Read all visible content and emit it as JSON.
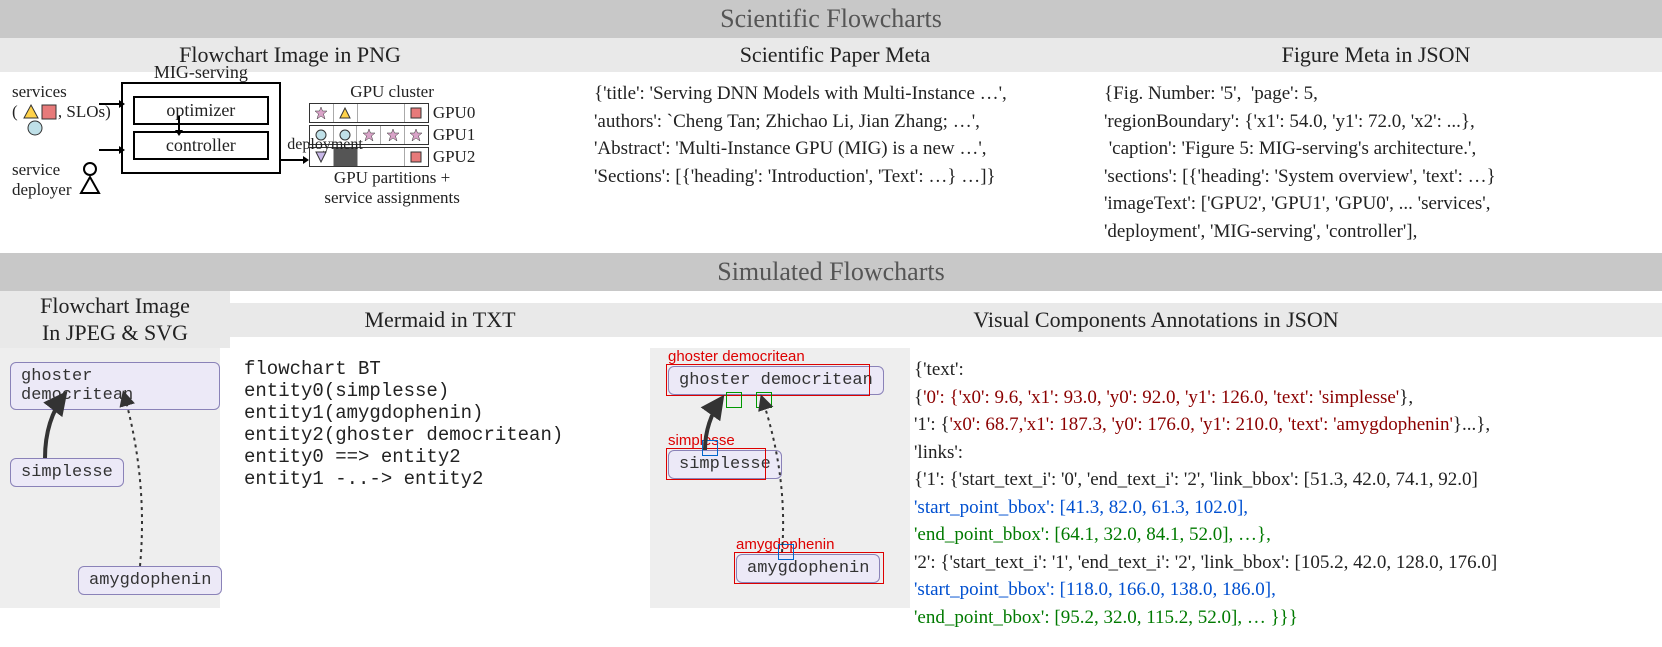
{
  "banners": {
    "scientific": "Scientific Flowcharts",
    "simulated": "Simulated Flowcharts"
  },
  "sci": {
    "col1_header": "Flowchart Image in PNG",
    "col2_header": "Scientific Paper Meta",
    "col3_header": "Figure Meta in JSON",
    "png": {
      "services_label": "services",
      "slos": ", SLOs)",
      "service_deployer": "service\ndeployer",
      "mig_title": "MIG-serving",
      "optimizer": "optimizer",
      "controller": "controller",
      "deployment": "deployment",
      "gpu_cluster": "GPU cluster",
      "gpu0": "GPU0",
      "gpu1": "GPU1",
      "gpu2": "GPU2",
      "gpu_footer": "GPU partitions +\nservice assignments"
    },
    "paper_meta": "{'title': 'Serving DNN Models with Multi-Instance …',\n'authors': `Cheng Tan; Zhichao Li, Jian Zhang; …',\n'Abstract': 'Multi-Instance GPU (MIG) is a new …',\n'Sections': [{'heading': 'Introduction', 'Text': …} …]}",
    "figure_meta": "{Fig. Number: '5',  'page': 5,\n'regionBoundary': {'x1': 54.0, 'y1': 72.0, 'x2': ...},\n 'caption': 'Figure 5: MIG-serving's architecture.',\n'sections': [{'heading': 'System overview', 'text': …}\n'imageText': ['GPU2', 'GPU1', 'GPU0', ... 'services',\n'deployment', 'MIG-serving', 'controller'],"
  },
  "sim": {
    "col1_header": "Flowchart Image\nIn JPEG & SVG",
    "col2_header": "Mermaid in TXT",
    "col3_header": "Visual Components Annotations in JSON",
    "nodes": {
      "ghoster": "ghoster democritean",
      "simplesse": "simplesse",
      "amygdophenin": "amygdophenin"
    },
    "mermaid": "flowchart BT\nentity0(simplesse)\nentity1(amygdophenin)\nentity2(ghoster democritean)\nentity0 ==> entity2\nentity1 -..-> entity2",
    "json": {
      "l1": "{'text':",
      "l2a": " {",
      "l2b": "'0': {'x0': 9.6, 'x1': 93.0, 'y0': 92.0, 'y1': 126.0, 'text': 'simplesse'",
      "l2c": "},",
      "l3a": "  '1': {",
      "l3b": "'x0': 68.7,'x1': 187.3, 'y0': 176.0, 'y1': 210.0,  'text': 'amygdophenin'",
      "l3c": "}...},",
      "l4": "'links':",
      "l5": "{'1': {'start_text_i': '0', 'end_text_i': '2', 'link_bbox': [51.3, 42.0, 74.1, 92.0]",
      "l6": "'start_point_bbox': [41.3, 82.0, 61.3, 102.0],",
      "l7": "'end_point_bbox': [64.1, 32.0, 84.1, 52.0], …},",
      "l8": " '2': {'start_text_i': '1', 'end_text_i': '2', 'link_bbox': [105.2, 42.0, 128.0, 176.0]",
      "l9": "'start_point_bbox': [118.0, 166.0, 138.0, 186.0],",
      "l10": "'end_point_bbox': [95.2, 32.0, 115.2, 52.0], … }}}"
    },
    "ann_labels": {
      "ghoster": "ghoster democritean",
      "simplesse": "simplesse",
      "amygdophenin": "amygdophenin"
    }
  }
}
